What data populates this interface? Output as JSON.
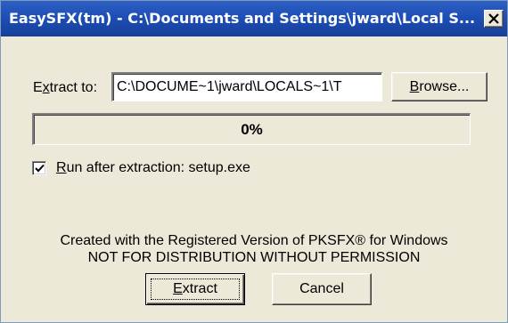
{
  "window": {
    "title": "EasySFX(tm) - C:\\Documents and Settings\\jward\\Local S...",
    "close_icon": "close-icon"
  },
  "extract": {
    "label_prefix": "E",
    "label_underlined": "x",
    "label_suffix": "tract to:",
    "path_value": "C:\\DOCUME~1\\jward\\LOCALS~1\\T",
    "browse_underlined": "B",
    "browse_suffix": "rowse..."
  },
  "progress": {
    "text": "0%",
    "value": 0
  },
  "run_after": {
    "checked": true,
    "label_underlined": "R",
    "label_suffix": "un after extraction: setup.exe"
  },
  "notice": {
    "line1": "Created with the Registered Version of PKSFX® for Windows",
    "line2": "NOT FOR DISTRIBUTION WITHOUT PERMISSION"
  },
  "buttons": {
    "extract_underlined": "E",
    "extract_suffix": "xtract",
    "cancel_label": "Cancel"
  },
  "colors": {
    "titlebar": "#1d4fb6",
    "face": "#ece9d8"
  }
}
